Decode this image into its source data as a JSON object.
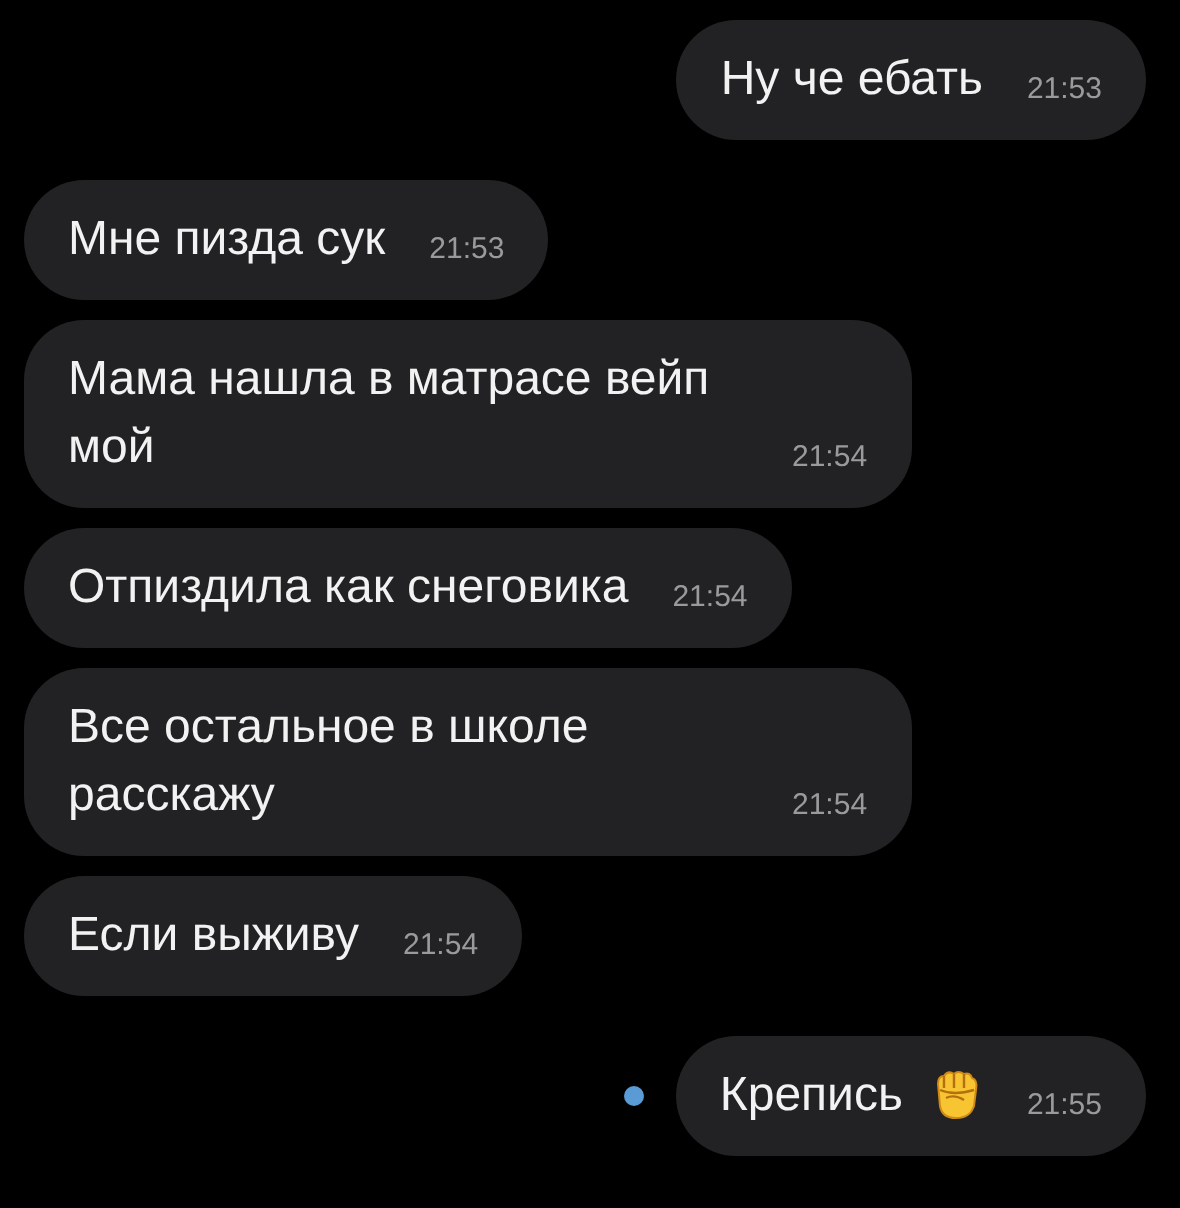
{
  "messages": [
    {
      "kind": "outgoing",
      "text": "Ну че ебать",
      "time": "21:53"
    },
    {
      "kind": "incoming",
      "text": "Мне пизда сук",
      "time": "21:53"
    },
    {
      "kind": "incoming",
      "text": "Мама нашла в матрасе вейп мой",
      "time": "21:54"
    },
    {
      "kind": "incoming",
      "text": "Отпиздила как снеговика",
      "time": "21:54"
    },
    {
      "kind": "incoming",
      "text": "Все остальное в школе расскажу",
      "time": "21:54"
    },
    {
      "kind": "incoming",
      "text": "Если выживу",
      "time": "21:54"
    },
    {
      "kind": "outgoing",
      "text": "Крепись",
      "time": "21:55",
      "unread": true,
      "emoji": true
    }
  ]
}
